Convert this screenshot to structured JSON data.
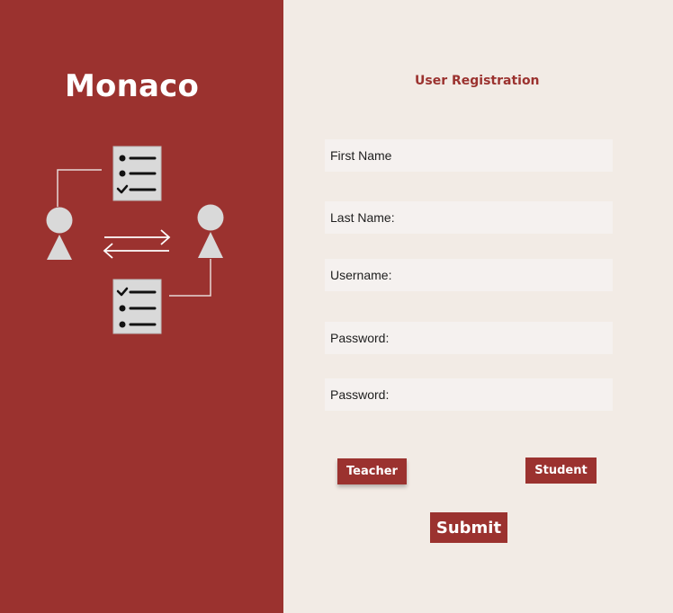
{
  "brand": {
    "name": "Monaco"
  },
  "form": {
    "title": "User Registration",
    "fields": [
      {
        "label": "First Name",
        "value": ""
      },
      {
        "label": "Last Name:",
        "value": ""
      },
      {
        "label": "Username:",
        "value": ""
      },
      {
        "label": "Password:",
        "value": ""
      },
      {
        "label": "Password:",
        "value": ""
      }
    ],
    "roles": {
      "teacher_label": "Teacher",
      "student_label": "Student"
    },
    "submit_label": "Submit"
  },
  "colors": {
    "accent": "#9b322f",
    "background": "#f2ebe5",
    "field_background": "#f5f1ef",
    "illustration_gray": "#d9d9d9"
  },
  "illustration": {
    "icons": [
      "person-icon",
      "checklist-icon",
      "exchange-arrows-icon",
      "person-icon",
      "checklist-icon"
    ]
  }
}
